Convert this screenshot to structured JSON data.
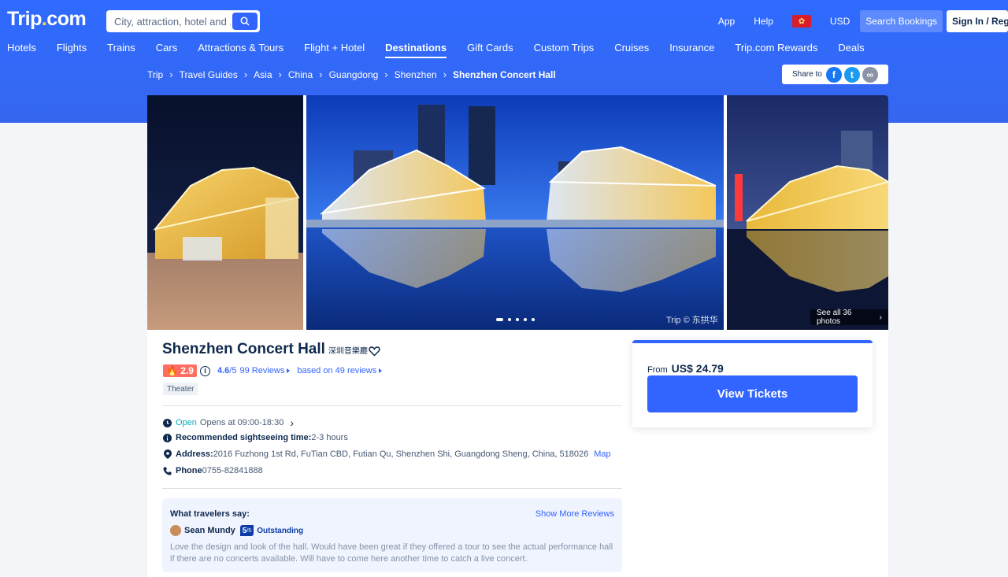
{
  "header": {
    "logo_main": "Trip",
    "logo_dot": ".",
    "logo_tail": "com",
    "search_placeholder": "City, attraction, hotel and ...",
    "links": {
      "app": "App",
      "help": "Help",
      "currency": "USD"
    },
    "search_bookings": "Search Bookings",
    "sign_in": "Sign In / Register"
  },
  "nav": [
    "Hotels",
    "Flights",
    "Trains",
    "Cars",
    "Attractions & Tours",
    "Flight + Hotel",
    "Destinations",
    "Gift Cards",
    "Custom Trips",
    "Cruises",
    "Insurance",
    "Trip.com Rewards",
    "Deals"
  ],
  "breadcrumb": [
    "Trip",
    "Travel Guides",
    "Asia",
    "China",
    "Guangdong",
    "Shenzhen",
    "Shenzhen Concert Hall"
  ],
  "share": {
    "label": "Share to"
  },
  "gallery": {
    "credit": "Trip © 东拱华",
    "see_all": "See all 36 photos"
  },
  "attraction": {
    "name": "Shenzhen Concert Hall",
    "local_name": "深圳音樂廳",
    "hot_score": "2.9",
    "rating": "4.6",
    "rating_max": "/5",
    "reviews_link": "99 Reviews",
    "based_on": "based on 49 reviews",
    "tag": "Theater",
    "open_status": "Open",
    "hours": "Opens at 09:00-18:30",
    "sightseeing_label": "Recommended sightseeing time:",
    "sightseeing_value": "2-3 hours",
    "address_label": "Address:",
    "address_value": "2016 Fuzhong 1st Rd, FuTian CBD, Futian Qu, Shenzhen Shi, Guangdong Sheng, China, 518026",
    "map_link": "Map",
    "phone_label": "Phone",
    "phone_value": "0755-82841888"
  },
  "reviews": {
    "title": "What travelers say:",
    "more": "Show More Reviews",
    "user": "Sean Mundy",
    "score": "5",
    "score_max": "/5",
    "level": "Outstanding",
    "text": "Love the design and look of the hall. Would have been great if they offered a tour to see the actual performance hall if there are no concerts available. Will have to come here another time to catch a live concert."
  },
  "pricing": {
    "from_label": "From",
    "price": "US$ 24.79",
    "button": "View Tickets"
  },
  "colors": {
    "brand": "#3264ff",
    "header": "#2f6bff",
    "open": "#06aebd",
    "hot": "#ff6f61"
  }
}
